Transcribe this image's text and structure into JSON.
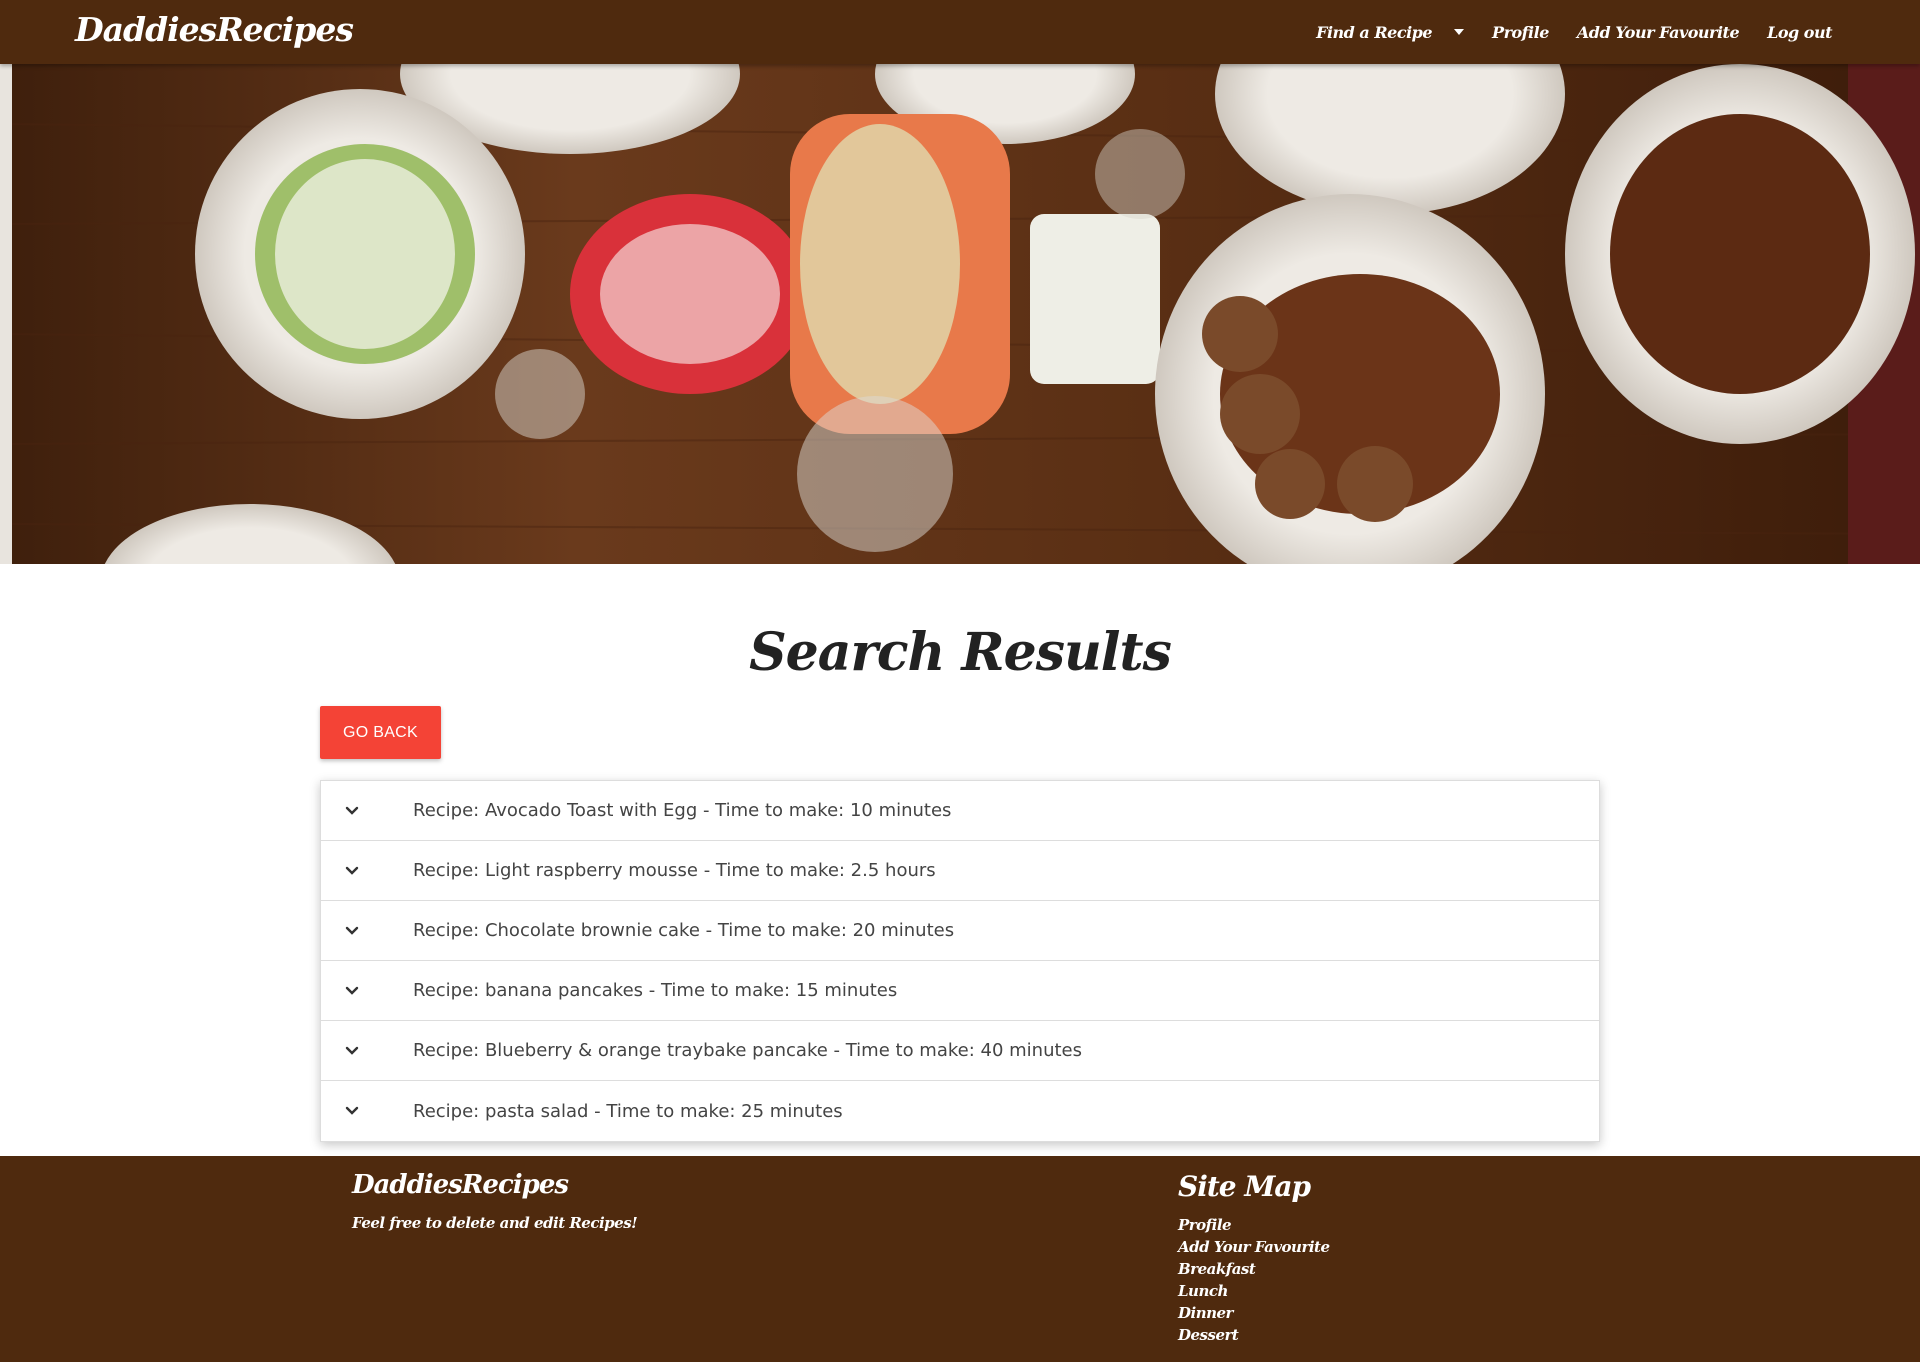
{
  "navbar": {
    "brand": "DaddiesRecipes",
    "links": [
      {
        "label": "Find a Recipe",
        "has_dropdown": true,
        "icon": "caret-down-icon"
      },
      {
        "label": "Profile"
      },
      {
        "label": "Add Your Favourite"
      },
      {
        "label": "Log out"
      }
    ],
    "background_color": "#4f2a0e"
  },
  "hero": {
    "image": "food-table-photo"
  },
  "main": {
    "title": "Search Results",
    "go_back_label": "GO BACK",
    "go_back_color": "#f44336",
    "results": [
      {
        "text": "Recipe: Avocado Toast with Egg - Time to make: 10 minutes",
        "icon": "chevron-down-icon"
      },
      {
        "text": "Recipe: Light raspberry mousse - Time to make: 2.5 hours",
        "icon": "chevron-down-icon"
      },
      {
        "text": "Recipe: Chocolate brownie cake - Time to make: 20 minutes",
        "icon": "chevron-down-icon"
      },
      {
        "text": "Recipe: banana pancakes - Time to make: 15 minutes",
        "icon": "chevron-down-icon"
      },
      {
        "text": "Recipe: Blueberry & orange traybake pancake - Time to make: 40 minutes",
        "icon": "chevron-down-icon"
      },
      {
        "text": "Recipe: pasta salad - Time to make: 25 minutes",
        "icon": "chevron-down-icon"
      }
    ]
  },
  "footer": {
    "brand": "DaddiesRecipes",
    "tagline": "Feel free to delete and edit Recipes!",
    "sitemap_title": "Site Map",
    "sitemap_links": [
      "Profile",
      "Add Your Favourite",
      "Breakfast",
      "Lunch",
      "Dinner",
      "Dessert"
    ],
    "background_color": "#4f2a0e"
  }
}
